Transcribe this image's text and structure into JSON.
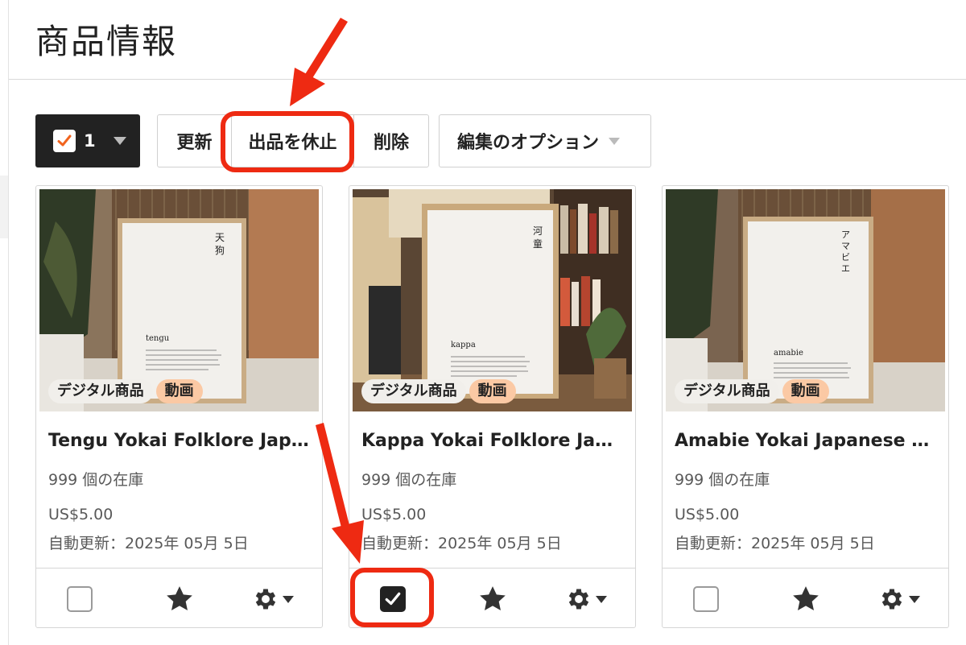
{
  "page": {
    "title": "商品情報"
  },
  "toolbar": {
    "selected_count": "1",
    "renew_label": "更新",
    "deactivate_label": "出品を休止",
    "delete_label": "削除",
    "edit_options_label": "編集のオプション"
  },
  "listings": [
    {
      "title": "Tengu Yokai Folklore Japa…",
      "stock": "999 個の在庫",
      "price": "US$5.00",
      "auto_renew": "自動更新：2025年 05月 5日",
      "badge_digital": "デジタル商品",
      "badge_video": "動画",
      "poster_kanji": "天\n狗",
      "poster_word": "tengu",
      "selected": false
    },
    {
      "title": "Kappa Yokai Folklore Japa…",
      "stock": "999 個の在庫",
      "price": "US$5.00",
      "auto_renew": "自動更新：2025年 05月 5日",
      "badge_digital": "デジタル商品",
      "badge_video": "動画",
      "poster_kanji": "河\n童",
      "poster_word": "kappa",
      "selected": true
    },
    {
      "title": "Amabie Yokai Japanese La…",
      "stock": "999 個の在庫",
      "price": "US$5.00",
      "auto_renew": "自動更新：2025年 05月 5日",
      "badge_digital": "デジタル商品",
      "badge_video": "動画",
      "poster_kanji": "ア\nマ\nビ\nエ",
      "poster_word": "amabie",
      "selected": false
    }
  ],
  "colors": {
    "annotation_red": "#ee2a12",
    "video_badge": "#fbc9a4",
    "dark_button": "#222222"
  }
}
